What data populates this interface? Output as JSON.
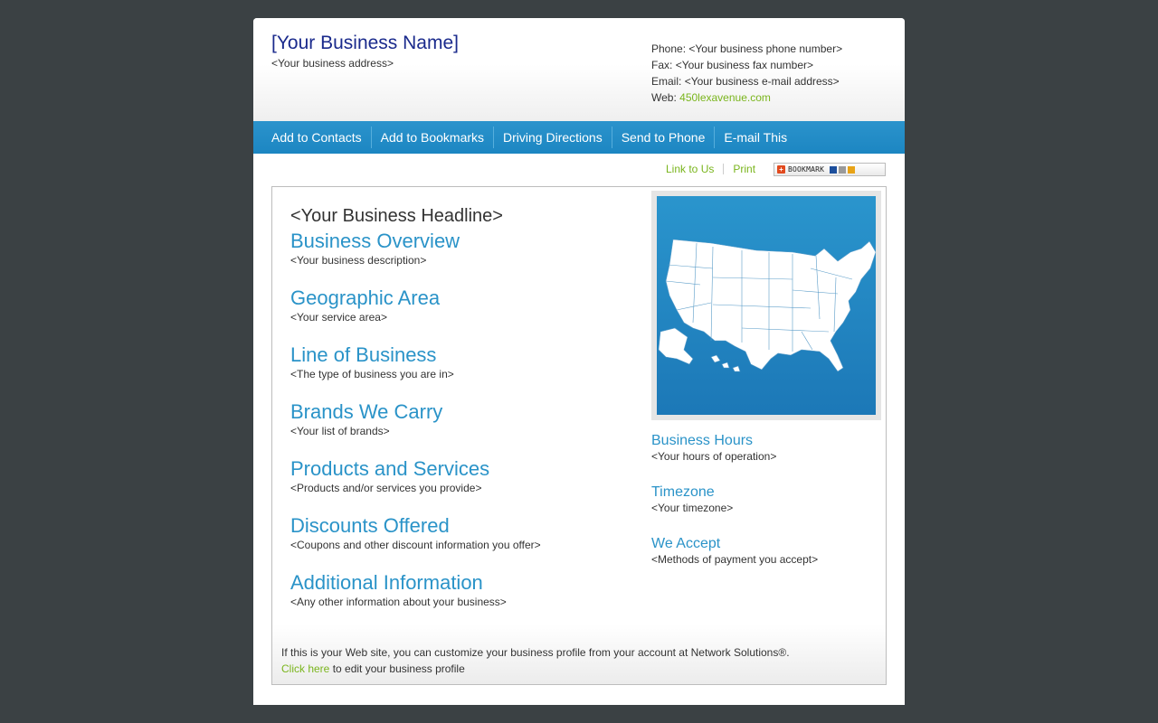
{
  "header": {
    "business_name": "[Your Business Name]",
    "business_address": "<Your business address>",
    "phone_label": "Phone:",
    "phone": "<Your business phone number>",
    "fax_label": "Fax:",
    "fax": "<Your business fax number>",
    "email_label": "Email:",
    "email": "<Your business e-mail address>",
    "web_label": "Web:",
    "web": "450lexavenue.com"
  },
  "nav": {
    "items": [
      "Add to Contacts",
      "Add to Bookmarks",
      "Driving Directions",
      "Send to Phone",
      "E-mail This"
    ]
  },
  "utility": {
    "link_to_us": "Link to Us",
    "print": "Print",
    "bookmark": "BOOKMARK"
  },
  "main": {
    "headline": "<Your Business Headline>",
    "sections": [
      {
        "title": "Business Overview",
        "desc": "<Your business description>"
      },
      {
        "title": "Geographic Area",
        "desc": "<Your service area>"
      },
      {
        "title": "Line of Business",
        "desc": "<The type of business you are in>"
      },
      {
        "title": "Brands We Carry",
        "desc": "<Your list of brands>"
      },
      {
        "title": "Products and Services",
        "desc": "<Products and/or services you provide>"
      },
      {
        "title": "Discounts Offered",
        "desc": "<Coupons and other discount information you offer>"
      },
      {
        "title": "Additional Information",
        "desc": "<Any other information about your business>"
      }
    ]
  },
  "side": {
    "sections": [
      {
        "title": "Business Hours",
        "desc": "<Your hours of operation>"
      },
      {
        "title": "Timezone",
        "desc": "<Your timezone>"
      },
      {
        "title": "We Accept",
        "desc": "<Methods of payment you accept>"
      }
    ]
  },
  "footer": {
    "line1": "If this is your Web site, you can customize your business profile from your account at Network Solutions®.",
    "click_here": "Click here",
    "line2_rest": " to edit your business profile"
  },
  "colors": {
    "accent": "#2a93c8",
    "nav_bg": "#1c86c2",
    "link_green": "#7ab51d",
    "brand_name": "#1a2a8c",
    "background": "#3b4144"
  },
  "icons": {
    "map": "usa-map-icon",
    "bookmark": "bookmark-plus-icon"
  }
}
